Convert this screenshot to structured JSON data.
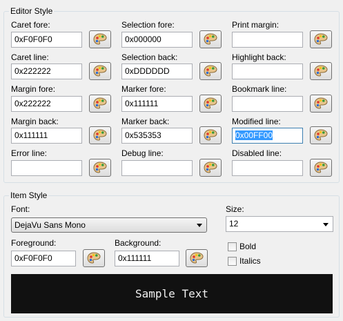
{
  "editor_style": {
    "title": "Editor Style",
    "fields": [
      {
        "label": "Caret fore:",
        "value": "0xF0F0F0"
      },
      {
        "label": "Selection fore:",
        "value": "0x000000"
      },
      {
        "label": "Print margin:",
        "value": ""
      },
      {
        "label": "Caret line:",
        "value": "0x222222"
      },
      {
        "label": "Selection back:",
        "value": "0xDDDDDD"
      },
      {
        "label": "Highlight back:",
        "value": ""
      },
      {
        "label": "Margin fore:",
        "value": "0x222222"
      },
      {
        "label": "Marker fore:",
        "value": "0x111111"
      },
      {
        "label": "Bookmark line:",
        "value": ""
      },
      {
        "label": "Margin back:",
        "value": "0x111111"
      },
      {
        "label": "Marker back:",
        "value": "0x535353"
      },
      {
        "label": "Modified line:",
        "value": "0x00FF00",
        "selected": true
      },
      {
        "label": "Error line:",
        "value": ""
      },
      {
        "label": "Debug line:",
        "value": ""
      },
      {
        "label": "Disabled line:",
        "value": ""
      }
    ]
  },
  "item_style": {
    "title": "Item Style",
    "font_label": "Font:",
    "font_value": "DejaVu Sans Mono",
    "size_label": "Size:",
    "size_value": "12",
    "foreground_label": "Foreground:",
    "foreground_value": "0xF0F0F0",
    "background_label": "Background:",
    "background_value": "0x111111",
    "bold_label": "Bold",
    "bold_checked": false,
    "italics_label": "Italics",
    "italics_checked": false,
    "sample_text": "Sample Text",
    "sample_fore_color": "#F0F0F0",
    "sample_back_color": "#111111"
  },
  "icons": {
    "palette_button": "palette-icon",
    "dropdown_arrow": "chevron-down-icon"
  }
}
